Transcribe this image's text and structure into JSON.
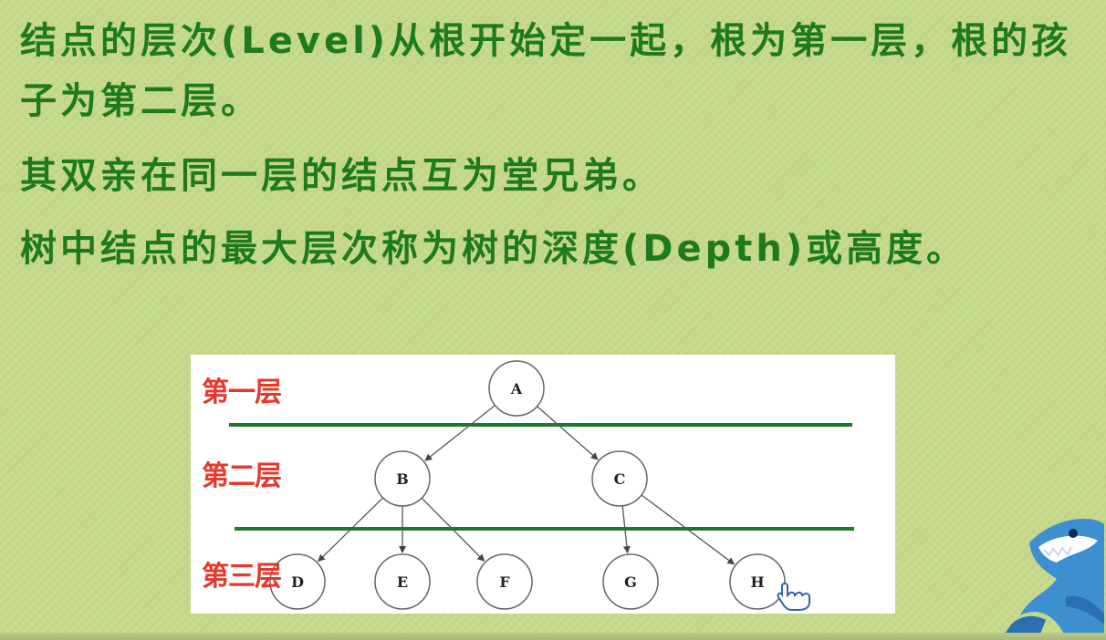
{
  "slide": {
    "paragraphs": [
      "结点的层次(Level)从根开始定一起，根为第一层，根的孩子为第二层。",
      "其双亲在同一层的结点互为堂兄弟。",
      "树中结点的最大层次称为树的深度(Depth)或高度。"
    ],
    "text_color": "#1f7a1f",
    "background_color": "#c5d98a"
  },
  "diagram": {
    "level_labels": [
      "第一层",
      "第二层",
      "第三层"
    ],
    "label_color": "#e8372b",
    "divider_color": "#1a7a2a",
    "nodes": [
      {
        "id": "A",
        "label": "A"
      },
      {
        "id": "B",
        "label": "B"
      },
      {
        "id": "C",
        "label": "C"
      },
      {
        "id": "D",
        "label": "D"
      },
      {
        "id": "E",
        "label": "E"
      },
      {
        "id": "F",
        "label": "F"
      },
      {
        "id": "G",
        "label": "G"
      },
      {
        "id": "H",
        "label": "H"
      }
    ],
    "edges": [
      [
        "A",
        "B"
      ],
      [
        "A",
        "C"
      ],
      [
        "B",
        "D"
      ],
      [
        "B",
        "E"
      ],
      [
        "B",
        "F"
      ],
      [
        "C",
        "G"
      ],
      [
        "C",
        "H"
      ]
    ]
  },
  "decorations": {
    "mascot_icon": "shark-mascot-icon",
    "cursor_icon": "hand-pointer-icon"
  }
}
